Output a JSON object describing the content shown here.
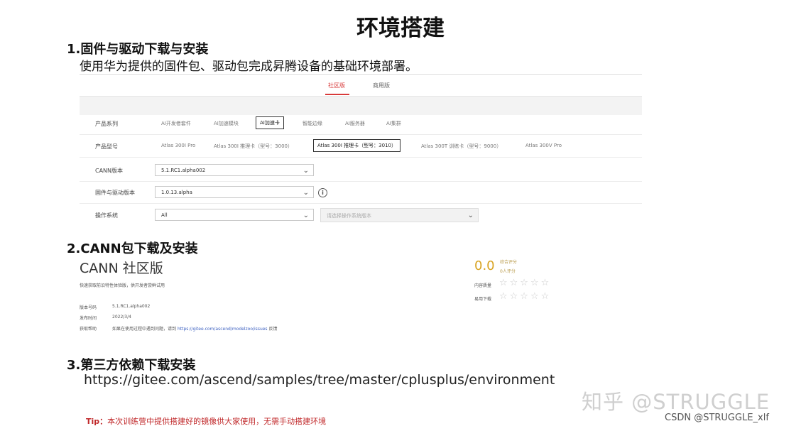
{
  "title": "环境搭建",
  "section1": {
    "heading": "1.固件与驱动下载与安装",
    "description": "使用华为提供的固件包、驱动包完成昇腾设备的基础环境部署。",
    "tabs": [
      "社区版",
      "商用版"
    ],
    "rows": {
      "series_label": "产品系列",
      "series_options": [
        "AI开发者套件",
        "AI加速模块",
        "AI加速卡",
        "智能边缘",
        "AI服务器",
        "AI集群"
      ],
      "model_label": "产品型号",
      "model_options": [
        "Atlas 300I Pro",
        "Atlas 300I 推理卡（型号：3000）",
        "Atlas 300I 推理卡（型号：3010）",
        "Atlas 300T 训练卡（型号：9000）",
        "Atlas 300V Pro"
      ],
      "cann_label": "CANN版本",
      "cann_value": "5.1.RC1.alpha002",
      "firmware_label": "固件与驱动版本",
      "firmware_value": "1.0.13.alpha",
      "os_label": "操作系统",
      "os_value": "All",
      "os_placeholder": "请选择操作系统版本"
    }
  },
  "section2": {
    "heading": "2.CANN包下载及安装",
    "product_title": "CANN 社区版",
    "subtitle": "快速获取前沿特性体验版，供开发者尝鲜试用",
    "version_label": "版本号码",
    "version_value": "5.1.RC1.alpha002",
    "date_label": "发布时间",
    "date_value": "2022/3/4",
    "feedback_label": "获取帮助",
    "feedback_text": "如果在使用过程中遇到问题，请到",
    "feedback_link": "https://gitee.com/ascend/modelzoo/issues",
    "feedback_suffix": "反馈",
    "score": "0.0",
    "score_line1": "综合评分",
    "score_line2": "0人评分",
    "rating_label": "内容质量",
    "rating_label2": "易用下载"
  },
  "section3": {
    "heading": "3.第三方依赖下载安装",
    "url": "https://gitee.com/ascend/samples/tree/master/cplusplus/environment"
  },
  "tip": {
    "label": "Tip：",
    "text": "本次训练营中提供搭建好的镜像供大家使用，无需手动搭建环境"
  },
  "watermarks": {
    "zhihu": "知乎 @STRUGGLE",
    "csdn": "CSDN @STRUGGLE_xlf"
  },
  "colors": {
    "accent": "#d83a3a",
    "tip": "#c0282a",
    "score": "#d8a321"
  }
}
